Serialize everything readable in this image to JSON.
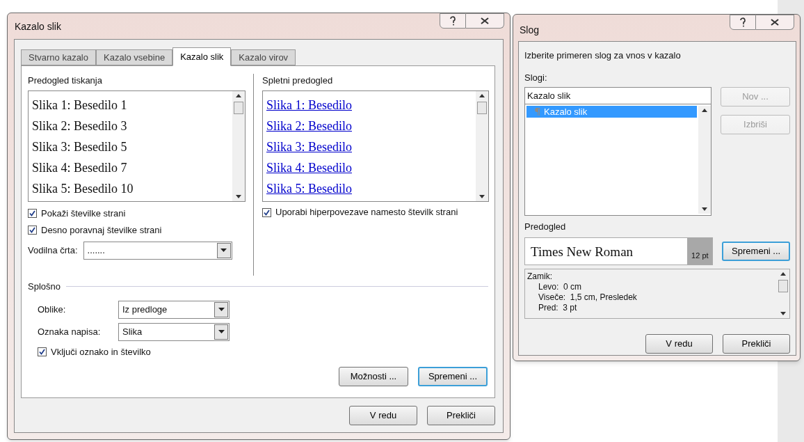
{
  "figures_dialog": {
    "title": "Kazalo slik",
    "tabs": [
      {
        "label": "Stvarno kazalo",
        "selected": false
      },
      {
        "label": "Kazalo vsebine",
        "selected": false
      },
      {
        "label": "Kazalo slik",
        "selected": true
      },
      {
        "label": "Kazalo virov",
        "selected": false
      }
    ],
    "print_preview": {
      "label": "Predogled tiskanja",
      "entries": [
        "Slika 1: Besedilo 1",
        "Slika 2: Besedilo 3",
        "Slika 3: Besedilo 5",
        "Slika 4: Besedilo 7",
        "Slika 5: Besedilo 10"
      ]
    },
    "web_preview": {
      "label": "Spletni predogled",
      "entries": [
        "Slika 1: Besedilo",
        "Slika 2: Besedilo",
        "Slika 3: Besedilo",
        "Slika 4: Besedilo",
        "Slika 5: Besedilo"
      ]
    },
    "left_checkboxes": [
      {
        "label": "Pokaži številke strani",
        "checked": true
      },
      {
        "label": "Desno poravnaj številke strani",
        "checked": true
      }
    ],
    "right_checkboxes": [
      {
        "label": "Uporabi hiperpovezave namesto številk strani",
        "checked": true
      }
    ],
    "tab_leader": {
      "label": "Vodilna črta:",
      "value": "......."
    },
    "general": {
      "label": "Splošno",
      "fields": [
        {
          "label": "Oblike:",
          "value": "Iz predloge"
        },
        {
          "label": "Oznaka napisa:",
          "value": "Slika"
        }
      ],
      "checkbox": {
        "label": "Vključi oznako in številko",
        "checked": true
      }
    },
    "tab_buttons": [
      {
        "label": "Možnosti ...",
        "focused": false
      },
      {
        "label": "Spremeni ...",
        "focused": true
      }
    ],
    "buttons": [
      {
        "label": "V redu"
      },
      {
        "label": "Prekliči"
      }
    ]
  },
  "style_dialog": {
    "title": "Slog",
    "instruction": "Izberite primeren slog za vnos v kazalo",
    "styles_label": "Slogi:",
    "style_name": "Kazalo slik",
    "styles": [
      {
        "name": "Kazalo slik",
        "selected": true
      }
    ],
    "side_buttons": [
      {
        "label": "Nov ...",
        "disabled": true
      },
      {
        "label": "Izbriši",
        "disabled": true
      }
    ],
    "preview_label": "Predogled",
    "preview_font": "Times New Roman",
    "preview_size": "12 pt",
    "modify_button": {
      "label": "Spremeni ...",
      "focused": true
    },
    "description": [
      "Zamik:",
      "Levo:  0 cm",
      "Viseče:  1,5 cm, Presledek",
      "Pred:  3 pt"
    ],
    "buttons": [
      {
        "label": "V redu"
      },
      {
        "label": "Prekliči"
      }
    ]
  }
}
